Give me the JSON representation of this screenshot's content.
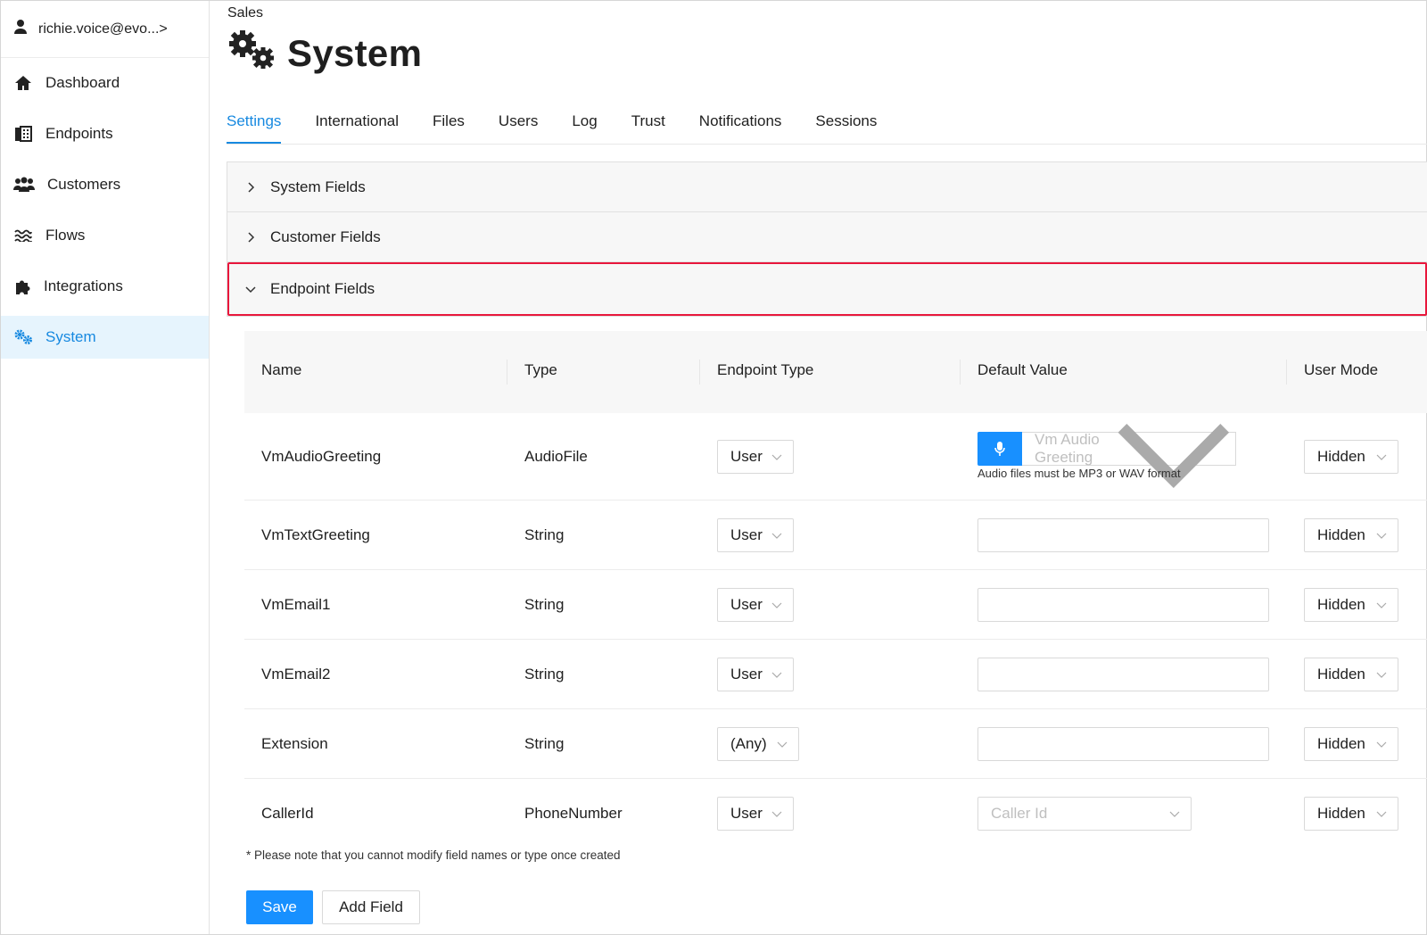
{
  "sidebar": {
    "user": "richie.voice@evo...",
    "user_chevron": ">",
    "items": [
      {
        "label": "Dashboard",
        "icon": "home-icon"
      },
      {
        "label": "Endpoints",
        "icon": "phone-book-icon"
      },
      {
        "label": "Customers",
        "icon": "users-icon"
      },
      {
        "label": "Flows",
        "icon": "waves-icon"
      },
      {
        "label": "Integrations",
        "icon": "puzzle-icon"
      },
      {
        "label": "System",
        "icon": "gears-icon",
        "active": true
      }
    ]
  },
  "header": {
    "breadcrumb": "Sales",
    "title": "System"
  },
  "tabs": [
    "Settings",
    "International",
    "Files",
    "Users",
    "Log",
    "Trust",
    "Notifications",
    "Sessions"
  ],
  "accordion": {
    "system_fields": "System Fields",
    "customer_fields": "Customer Fields",
    "endpoint_fields": "Endpoint Fields"
  },
  "table": {
    "columns": [
      "Name",
      "Type",
      "Endpoint Type",
      "Default Value",
      "User Mode"
    ],
    "rows": [
      {
        "name": "VmAudioGreeting",
        "type": "AudioFile",
        "endpoint_type": "User",
        "default_value": "Vm Audio Greeting",
        "hint": "Audio files must be MP3 or WAV format",
        "user_mode": "Hidden"
      },
      {
        "name": "VmTextGreeting",
        "type": "String",
        "endpoint_type": "User",
        "default_value": "",
        "user_mode": "Hidden"
      },
      {
        "name": "VmEmail1",
        "type": "String",
        "endpoint_type": "User",
        "default_value": "",
        "user_mode": "Hidden"
      },
      {
        "name": "VmEmail2",
        "type": "String",
        "endpoint_type": "User",
        "default_value": "",
        "user_mode": "Hidden"
      },
      {
        "name": "Extension",
        "type": "String",
        "endpoint_type": "(Any)",
        "default_value": "",
        "user_mode": "Hidden"
      },
      {
        "name": "CallerId",
        "type": "PhoneNumber",
        "endpoint_type": "User",
        "default_value": "Caller Id",
        "user_mode": "Hidden"
      }
    ]
  },
  "note": "* Please note that you cannot modify field names or type once created",
  "buttons": {
    "save": "Save",
    "add_field": "Add Field"
  },
  "colors": {
    "accent": "#1890ff",
    "highlight": "#e8173c",
    "active_bg": "#e6f4fd"
  }
}
